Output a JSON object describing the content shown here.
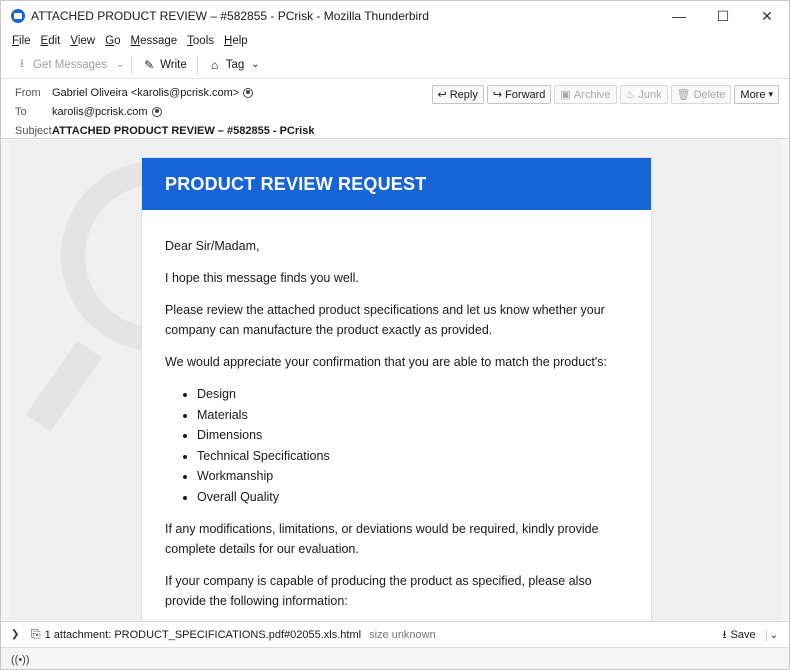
{
  "window": {
    "title": "ATTACHED PRODUCT REVIEW – #582855 - PCrisk - Mozilla Thunderbird",
    "controls": {
      "minimize": "—",
      "maximize": "☐",
      "close": "✕"
    }
  },
  "menu": [
    {
      "label": "File",
      "key": "F",
      "rest": "ile"
    },
    {
      "label": "Edit",
      "key": "E",
      "rest": "dit"
    },
    {
      "label": "View",
      "key": "V",
      "rest": "iew"
    },
    {
      "label": "Go",
      "key": "G",
      "rest": "o"
    },
    {
      "label": "Message",
      "key": "M",
      "rest": "essage"
    },
    {
      "label": "Tools",
      "key": "T",
      "rest": "ools"
    },
    {
      "label": "Help",
      "key": "H",
      "rest": "elp"
    }
  ],
  "toolbar": {
    "get_messages": "Get Messages",
    "write": "Write",
    "tag": "Tag"
  },
  "header": {
    "from_label": "From",
    "from_value": "Gabriel Oliveira <karolis@pcrisk.com>",
    "to_label": "To",
    "to_value": "karolis@pcrisk.com",
    "subject_label": "Subject",
    "subject_value": "ATTACHED PRODUCT REVIEW – #582855 - PCrisk"
  },
  "actions": {
    "reply": "Reply",
    "forward": "Forward",
    "archive": "Archive",
    "junk": "Junk",
    "delete": "Delete",
    "more": "More"
  },
  "email": {
    "banner_title": "PRODUCT REVIEW REQUEST",
    "greeting": "Dear Sir/Madam,",
    "p1": "I hope this message finds you well.",
    "p2": "Please review the attached product specifications and let us know whether your company can manufacture the product exactly as provided.",
    "p3": "We would appreciate your confirmation that you are able to match the product's:",
    "list": [
      "Design",
      "Materials",
      "Dimensions",
      "Technical Specifications",
      "Workmanship",
      "Overall Quality"
    ],
    "p4": "If any modifications, limitations, or deviations would be required, kindly provide complete details for our evaluation.",
    "p5": "If your company is capable of producing the product as specified, please also provide the following information:"
  },
  "attachment": {
    "text": "1 attachment: PRODUCT_SPECIFICATIONS.pdf#02055.xls.html",
    "size": "size unknown",
    "save": "Save"
  },
  "icons": {
    "app": "thunderbird-icon",
    "get_messages": "download-icon",
    "write": "pencil-icon",
    "tag": "tag-icon",
    "reply": "reply-icon",
    "forward": "forward-icon",
    "archive": "archive-icon",
    "junk": "junk-icon",
    "delete": "trash-icon",
    "attachment": "paperclip-icon",
    "save": "download-icon",
    "status": "connection-icon"
  }
}
